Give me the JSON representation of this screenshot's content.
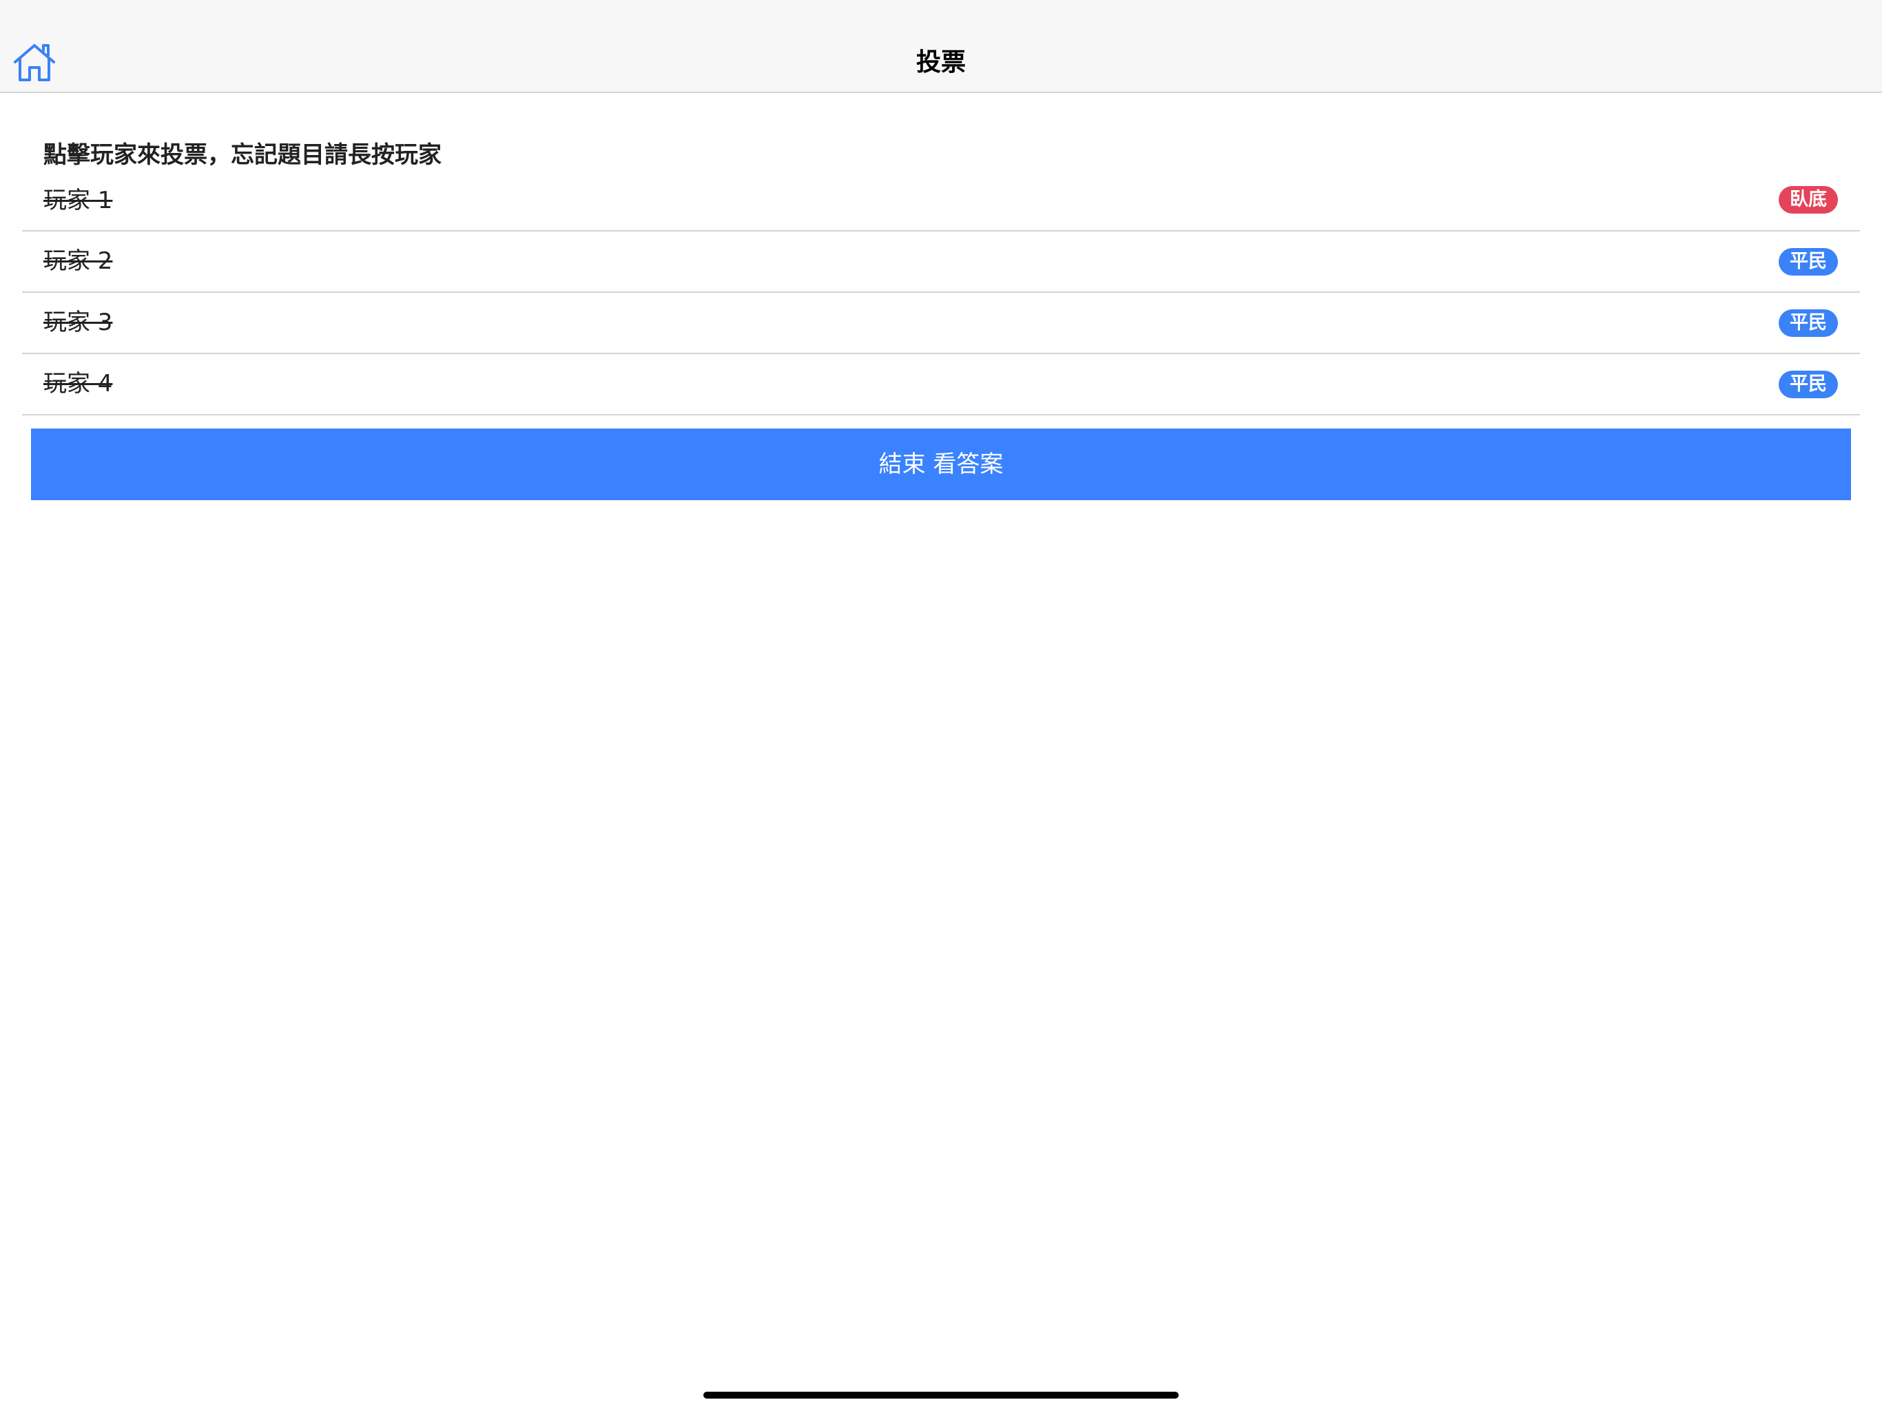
{
  "nav": {
    "title": "投票",
    "home_icon": "home-icon"
  },
  "instructions": "點擊玩家來投票，忘記題目請長按玩家",
  "players": [
    {
      "name": "玩家 1",
      "role": "臥底",
      "role_color": "#e5435a",
      "eliminated": true
    },
    {
      "name": "玩家 2",
      "role": "平民",
      "role_color": "#3a82f7",
      "eliminated": true
    },
    {
      "name": "玩家 3",
      "role": "平民",
      "role_color": "#3a82f7",
      "eliminated": true
    },
    {
      "name": "玩家 4",
      "role": "平民",
      "role_color": "#3a82f7",
      "eliminated": true
    }
  ],
  "end_button": {
    "label": "結束 看答案",
    "color": "#3a82ff"
  },
  "colors": {
    "accent": "#3a82ff",
    "nav_background": "#f7f7f7",
    "separator": "#d4d4d6"
  }
}
